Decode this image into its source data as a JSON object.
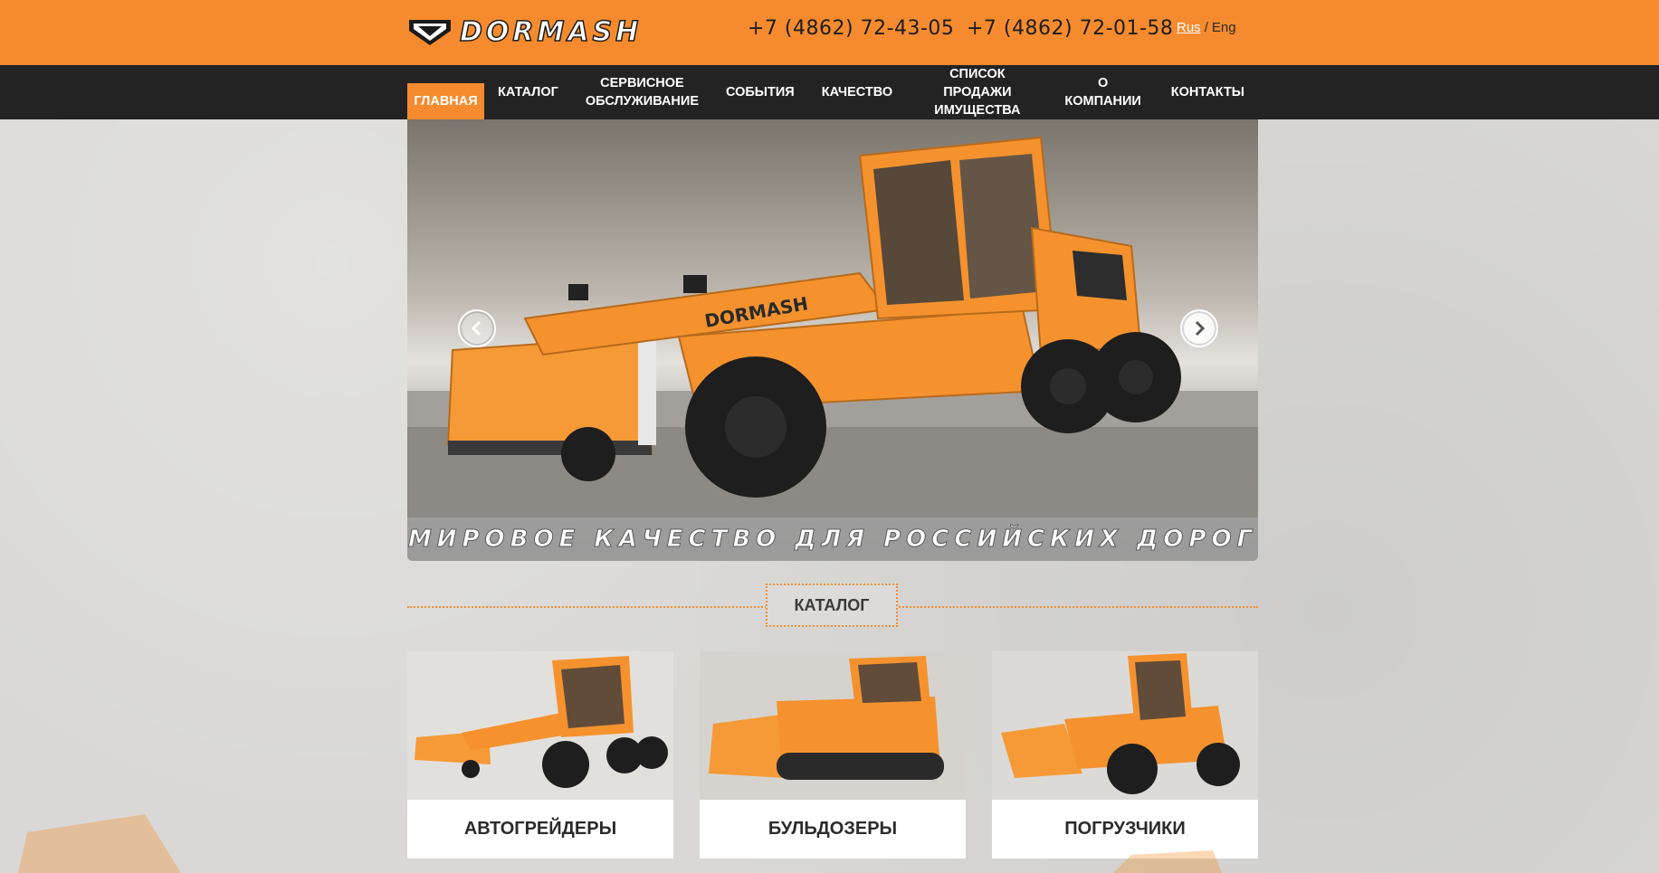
{
  "header": {
    "logo_text": "DORMASH",
    "phone1": "+7 (4862) 72-43-05",
    "phone2": "+7 (4862) 72-01-58",
    "lang_rus": "Rus",
    "lang_sep": "/",
    "lang_eng": "Eng"
  },
  "nav": {
    "items": [
      {
        "label": "ГЛАВНАЯ"
      },
      {
        "label": "КАТАЛОГ"
      },
      {
        "label": "СЕРВИСНОЕ\nОБСЛУЖИВАНИЕ"
      },
      {
        "label": "СОБЫТИЯ"
      },
      {
        "label": "КАЧЕСТВО"
      },
      {
        "label": "СПИСОК ПРОДАЖИ\nИМУЩЕСТВА"
      },
      {
        "label": "О КОМПАНИИ"
      },
      {
        "label": "КОНТАКТЫ"
      }
    ]
  },
  "slider": {
    "caption": "МИРОВОЕ КАЧЕСТВО ДЛЯ РОССИЙСКИХ ДОРОГ",
    "machine_brand": "DORMASH"
  },
  "catalog": {
    "title": "КАТАЛОГ",
    "cards": [
      {
        "label": "АВТОГРЕЙДЕРЫ"
      },
      {
        "label": "БУЛЬДОЗЕРЫ"
      },
      {
        "label": "ПОГРУЗЧИКИ"
      }
    ]
  },
  "colors": {
    "accent": "#f58b2e",
    "nav_bg": "#232323",
    "page_bg": "#d9d8d6"
  },
  "icons": {
    "prev": "chevron-left-icon",
    "next": "chevron-right-icon",
    "logo": "dormash-logo-mark"
  }
}
